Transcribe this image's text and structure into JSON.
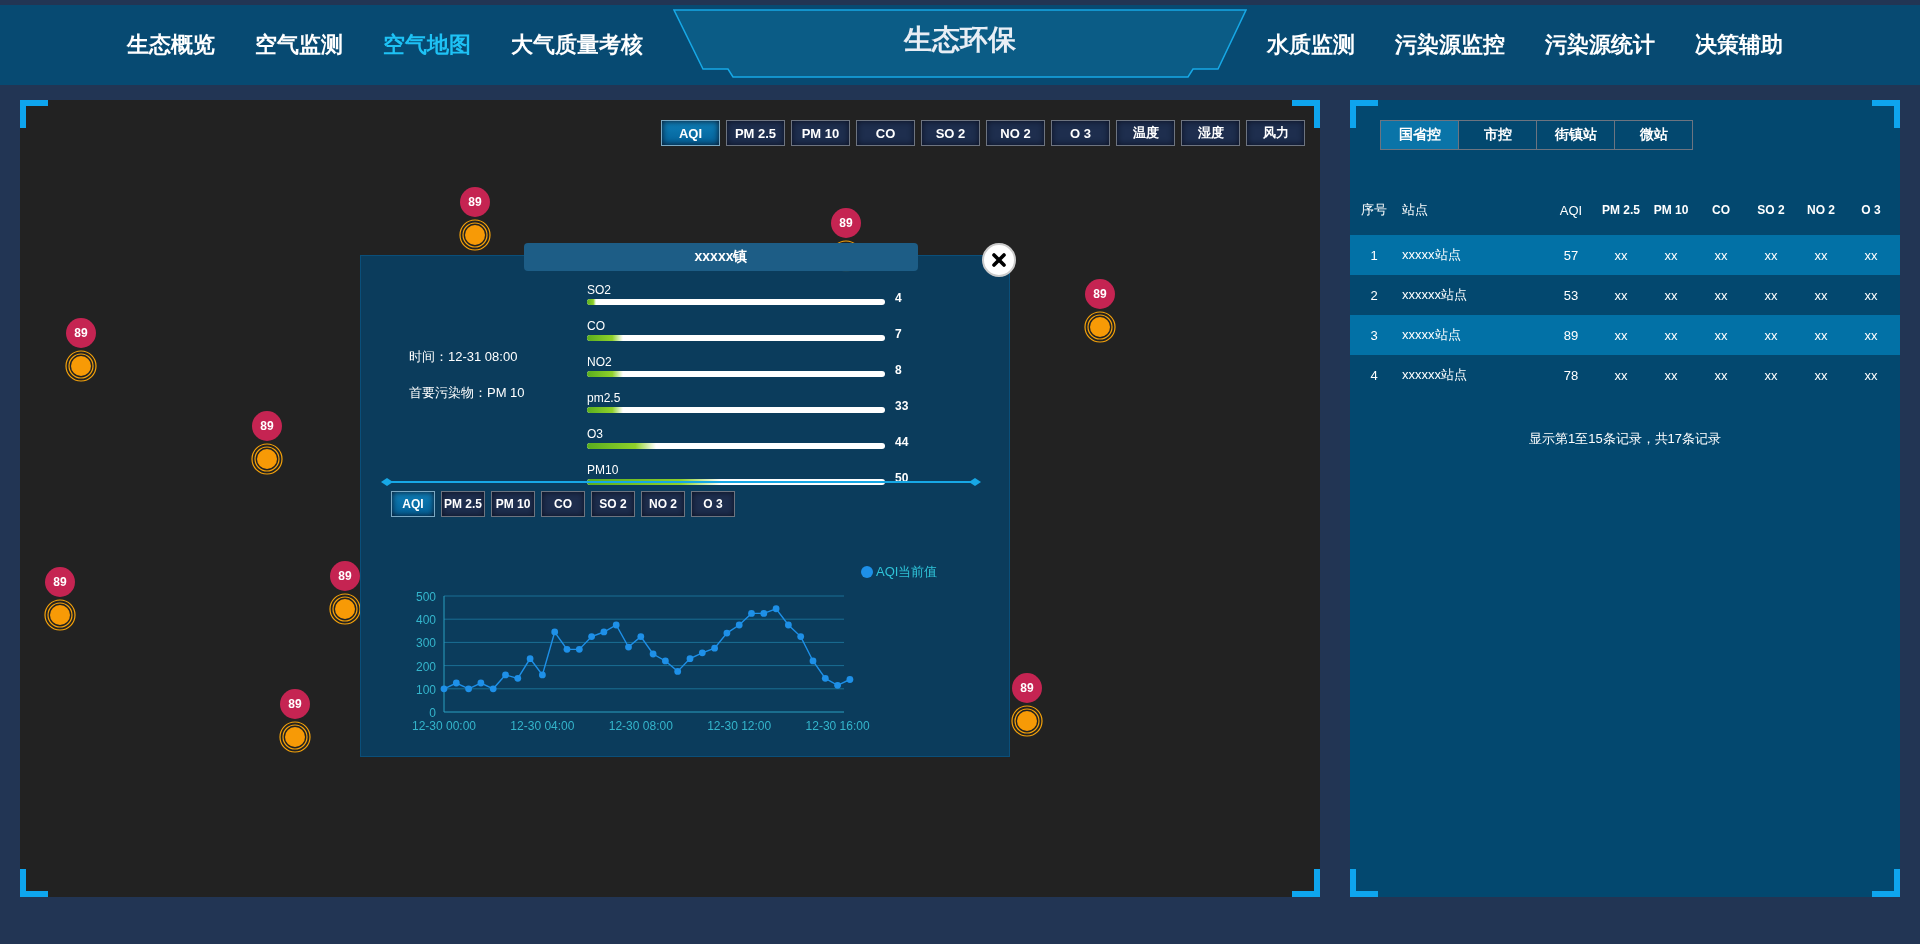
{
  "nav": {
    "left": [
      {
        "label": "生态概览",
        "selected": false
      },
      {
        "label": "空气监测",
        "selected": false
      },
      {
        "label": "空气地图",
        "selected": true
      },
      {
        "label": "大气质量考核",
        "selected": false
      }
    ],
    "title": "生态环保",
    "right": [
      {
        "label": "水质监测",
        "selected": false
      },
      {
        "label": "污染源监控",
        "selected": false
      },
      {
        "label": "污染源统计",
        "selected": false
      },
      {
        "label": "决策辅助",
        "selected": false
      }
    ]
  },
  "map": {
    "toolbar": [
      {
        "label": "AQI",
        "selected": true
      },
      {
        "label": "PM 2.5",
        "selected": false
      },
      {
        "label": "PM 10",
        "selected": false
      },
      {
        "label": "CO",
        "selected": false
      },
      {
        "label": "SO 2",
        "selected": false
      },
      {
        "label": "NO 2",
        "selected": false
      },
      {
        "label": "O 3",
        "selected": false
      },
      {
        "label": "温度",
        "selected": false
      },
      {
        "label": "湿度",
        "selected": false
      },
      {
        "label": "风力",
        "selected": false
      }
    ],
    "markers": [
      {
        "value": "89"
      },
      {
        "value": "89"
      },
      {
        "value": "89"
      },
      {
        "value": "89"
      },
      {
        "value": "89"
      },
      {
        "value": "89"
      },
      {
        "value": "89"
      },
      {
        "value": "89"
      },
      {
        "value": "89"
      }
    ],
    "popup": {
      "title": "xxxxx镇",
      "time": "时间：12-31 08:00",
      "pollutant": "首要污染物：PM 10",
      "bars": [
        {
          "name": "SO2",
          "level": 0.03,
          "reading": "4"
        },
        {
          "name": "CO",
          "level": 0.12,
          "reading": "7"
        },
        {
          "name": "NO2",
          "level": 0.12,
          "reading": "8"
        },
        {
          "name": "pm2.5",
          "level": 0.12,
          "reading": "33"
        },
        {
          "name": "O3",
          "level": 0.23,
          "reading": "44"
        },
        {
          "name": "PM10",
          "level": 0.45,
          "reading": "50"
        }
      ],
      "tabs": [
        {
          "label": "AQI",
          "selected": true
        },
        {
          "label": "PM 2.5",
          "selected": false
        },
        {
          "label": "PM 10",
          "selected": false
        },
        {
          "label": "CO",
          "selected": false
        },
        {
          "label": "SO 2",
          "selected": false
        },
        {
          "label": "NO 2",
          "selected": false
        },
        {
          "label": "O 3",
          "selected": false
        }
      ],
      "chart_data": {
        "type": "line",
        "grid": true,
        "categories": [
          "12-30 00:00",
          null,
          null,
          null,
          null,
          null,
          null,
          null,
          "12-30 04:00",
          null,
          null,
          null,
          null,
          null,
          null,
          null,
          "12-30 08:00",
          null,
          null,
          null,
          null,
          null,
          null,
          null,
          "12-30 12:00",
          null,
          null,
          null,
          null,
          null,
          null,
          null,
          "12-30 16:00",
          null
        ],
        "series": [
          {
            "name": "AQI当前值",
            "color": "#1e90e8",
            "marker": "circle",
            "values": [
              100,
              125,
              100,
              125,
              100,
              160,
              145,
              230,
              160,
              345,
              270,
              270,
              325,
              345,
              375,
              280,
              325,
              250,
              220,
              175,
              230,
              255,
              275,
              340,
              375,
              425,
              425,
              445,
              375,
              325,
              220,
              145,
              115,
              140
            ]
          }
        ],
        "ylim": [
          0,
          500
        ],
        "yticks": [
          0,
          100,
          200,
          300,
          400,
          500
        ]
      }
    }
  },
  "panel": {
    "tabs": [
      {
        "label": "国省控",
        "selected": true
      },
      {
        "label": "市控",
        "selected": false
      },
      {
        "label": "街镇站",
        "selected": false
      },
      {
        "label": "微站",
        "selected": false
      }
    ],
    "columns": [
      "序号",
      "站点",
      "AQI",
      "PM 2.5",
      "PM 10",
      "CO",
      "SO 2",
      "NO 2",
      "O 3"
    ],
    "rows": [
      [
        "1",
        "xxxxx站点",
        "57",
        "xx",
        "xx",
        "xx",
        "xx",
        "xx",
        "xx"
      ],
      [
        "2",
        "xxxxxx站点",
        "53",
        "xx",
        "xx",
        "xx",
        "xx",
        "xx",
        "xx"
      ],
      [
        "3",
        "xxxxx站点",
        "89",
        "xx",
        "xx",
        "xx",
        "xx",
        "xx",
        "xx"
      ],
      [
        "4",
        "xxxxxx站点",
        "78",
        "xx",
        "xx",
        "xx",
        "xx",
        "xx",
        "xx"
      ]
    ],
    "footer": "显示第1至15条记录，共17条记录"
  }
}
